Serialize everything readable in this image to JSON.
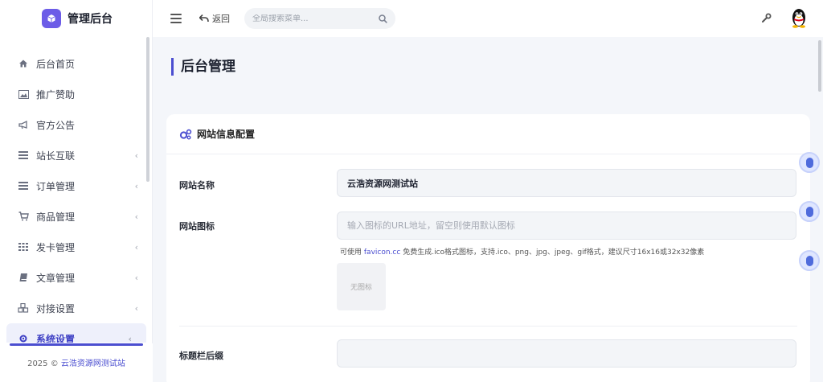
{
  "app": {
    "title": "管理后台"
  },
  "sidebar": {
    "items": [
      {
        "label": "后台首页",
        "icon": "home-icon",
        "chevron": ""
      },
      {
        "label": "推广赞助",
        "icon": "image-icon",
        "chevron": ""
      },
      {
        "label": "官方公告",
        "icon": "bullhorn-icon",
        "chevron": ""
      },
      {
        "label": "站长互联",
        "icon": "list-icon",
        "chevron": "‹"
      },
      {
        "label": "订单管理",
        "icon": "list-icon",
        "chevron": "‹"
      },
      {
        "label": "商品管理",
        "icon": "cart-icon",
        "chevron": "‹"
      },
      {
        "label": "发卡管理",
        "icon": "grid-icon",
        "chevron": "‹"
      },
      {
        "label": "文章管理",
        "icon": "book-icon",
        "chevron": "‹"
      },
      {
        "label": "对接设置",
        "icon": "cubes-icon",
        "chevron": "‹"
      },
      {
        "label": "系统设置",
        "icon": "gear-icon",
        "chevron": "‹"
      }
    ],
    "footer": {
      "year": "2025 ©",
      "site": "云浩资源网测试站"
    }
  },
  "header": {
    "back_label": "返回",
    "search_placeholder": "全局搜索菜单..."
  },
  "page": {
    "title": "后台管理"
  },
  "card": {
    "title": "网站信息配置",
    "fields": {
      "site_name": {
        "label": "网站名称",
        "value": "云浩资源网测试站"
      },
      "site_icon": {
        "label": "网站图标",
        "placeholder": "输入图标的URL地址，留空则使用默认图标"
      },
      "title_suffix": {
        "label": "标题栏后缀",
        "value": ""
      }
    },
    "hint": {
      "prefix": "可使用",
      "link": "favicon.cc",
      "suffix": "免费生成.ico格式图标，支持.ico、png、jpg、jpeg、gif格式，建议尺寸16x16或32x32像素"
    },
    "no_icon_label": "无图标"
  },
  "colors": {
    "accent": "#4b4ed0",
    "brand": "#6c5ce7"
  }
}
